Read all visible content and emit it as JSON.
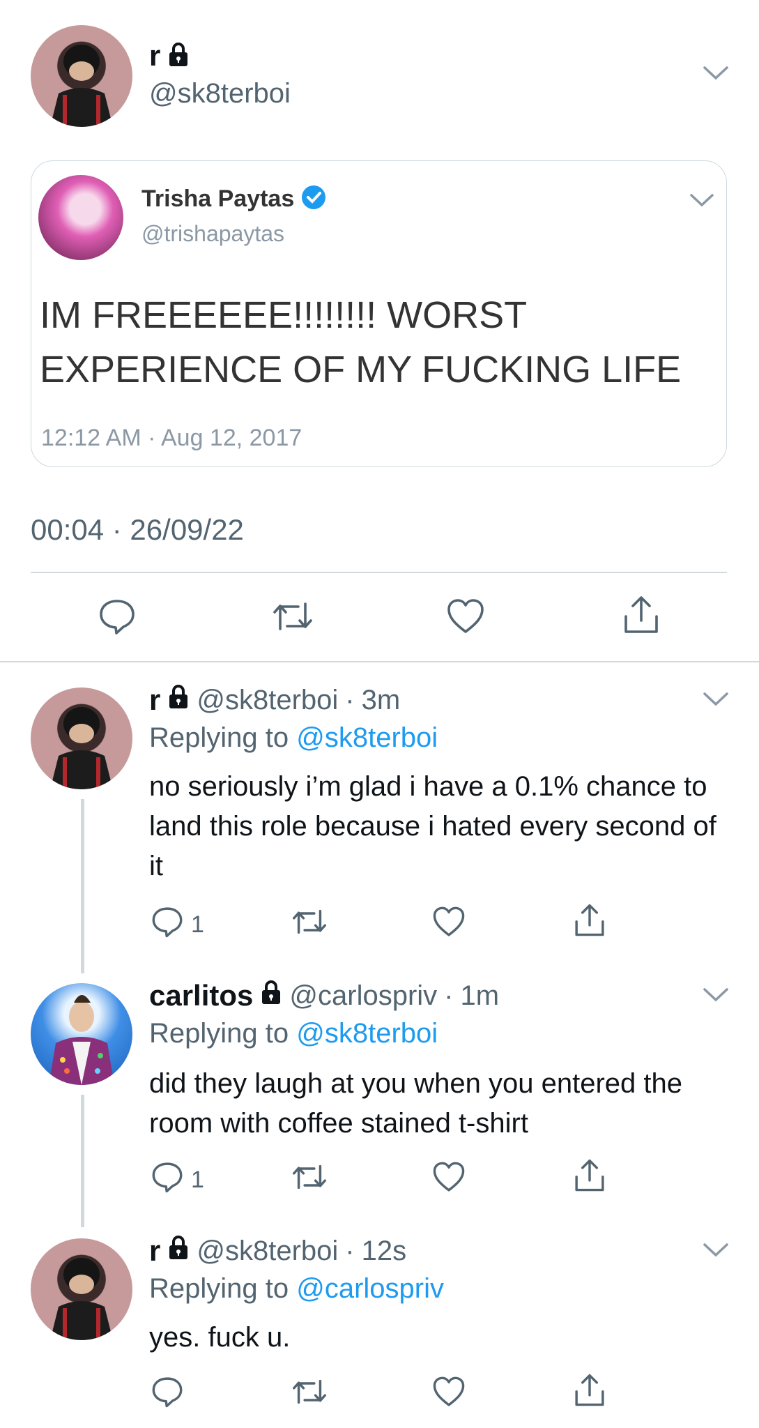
{
  "main_tweet": {
    "name": "r",
    "handle": "@sk8terboi",
    "timestamp": "00:04 · 26/09/22",
    "quoted": {
      "name": "Trisha Paytas",
      "handle": "@trishapaytas",
      "text": "IM FREEEEEE!!!!!!!! WORST EXPERIENCE OF MY FUCKING LIFE",
      "timestamp": "12:12 AM · Aug 12, 2017"
    }
  },
  "replies": [
    {
      "name": "r",
      "handle": "@sk8terboi",
      "time": "3m",
      "replying_label": "Replying to",
      "replying_to": "@sk8terboi",
      "text": "no seriously i’m glad i have a 0.1% chance to land this role because i hated every second of it",
      "reply_count": "1"
    },
    {
      "name": "carlitos",
      "handle": "@carlospriv",
      "time": "1m",
      "replying_label": "Replying to",
      "replying_to": "@sk8terboi",
      "text": "did they laugh at you when you entered the room with coffee stained t-shirt",
      "reply_count": "1"
    },
    {
      "name": "r",
      "handle": "@sk8terboi",
      "time": "12s",
      "replying_label": "Replying to",
      "replying_to": "@carlospriv",
      "text": "yes. fuck u.",
      "reply_count": ""
    }
  ],
  "icons": {
    "lock": "lock-icon",
    "verified": "verified-badge-icon",
    "reply": "reply-icon",
    "retweet": "retweet-icon",
    "like": "like-icon",
    "share": "share-icon",
    "chevron": "chevron-down-icon"
  },
  "colors": {
    "accent": "#1d9bf0",
    "secondary_text": "#536471",
    "divider": "#cfd9de"
  }
}
